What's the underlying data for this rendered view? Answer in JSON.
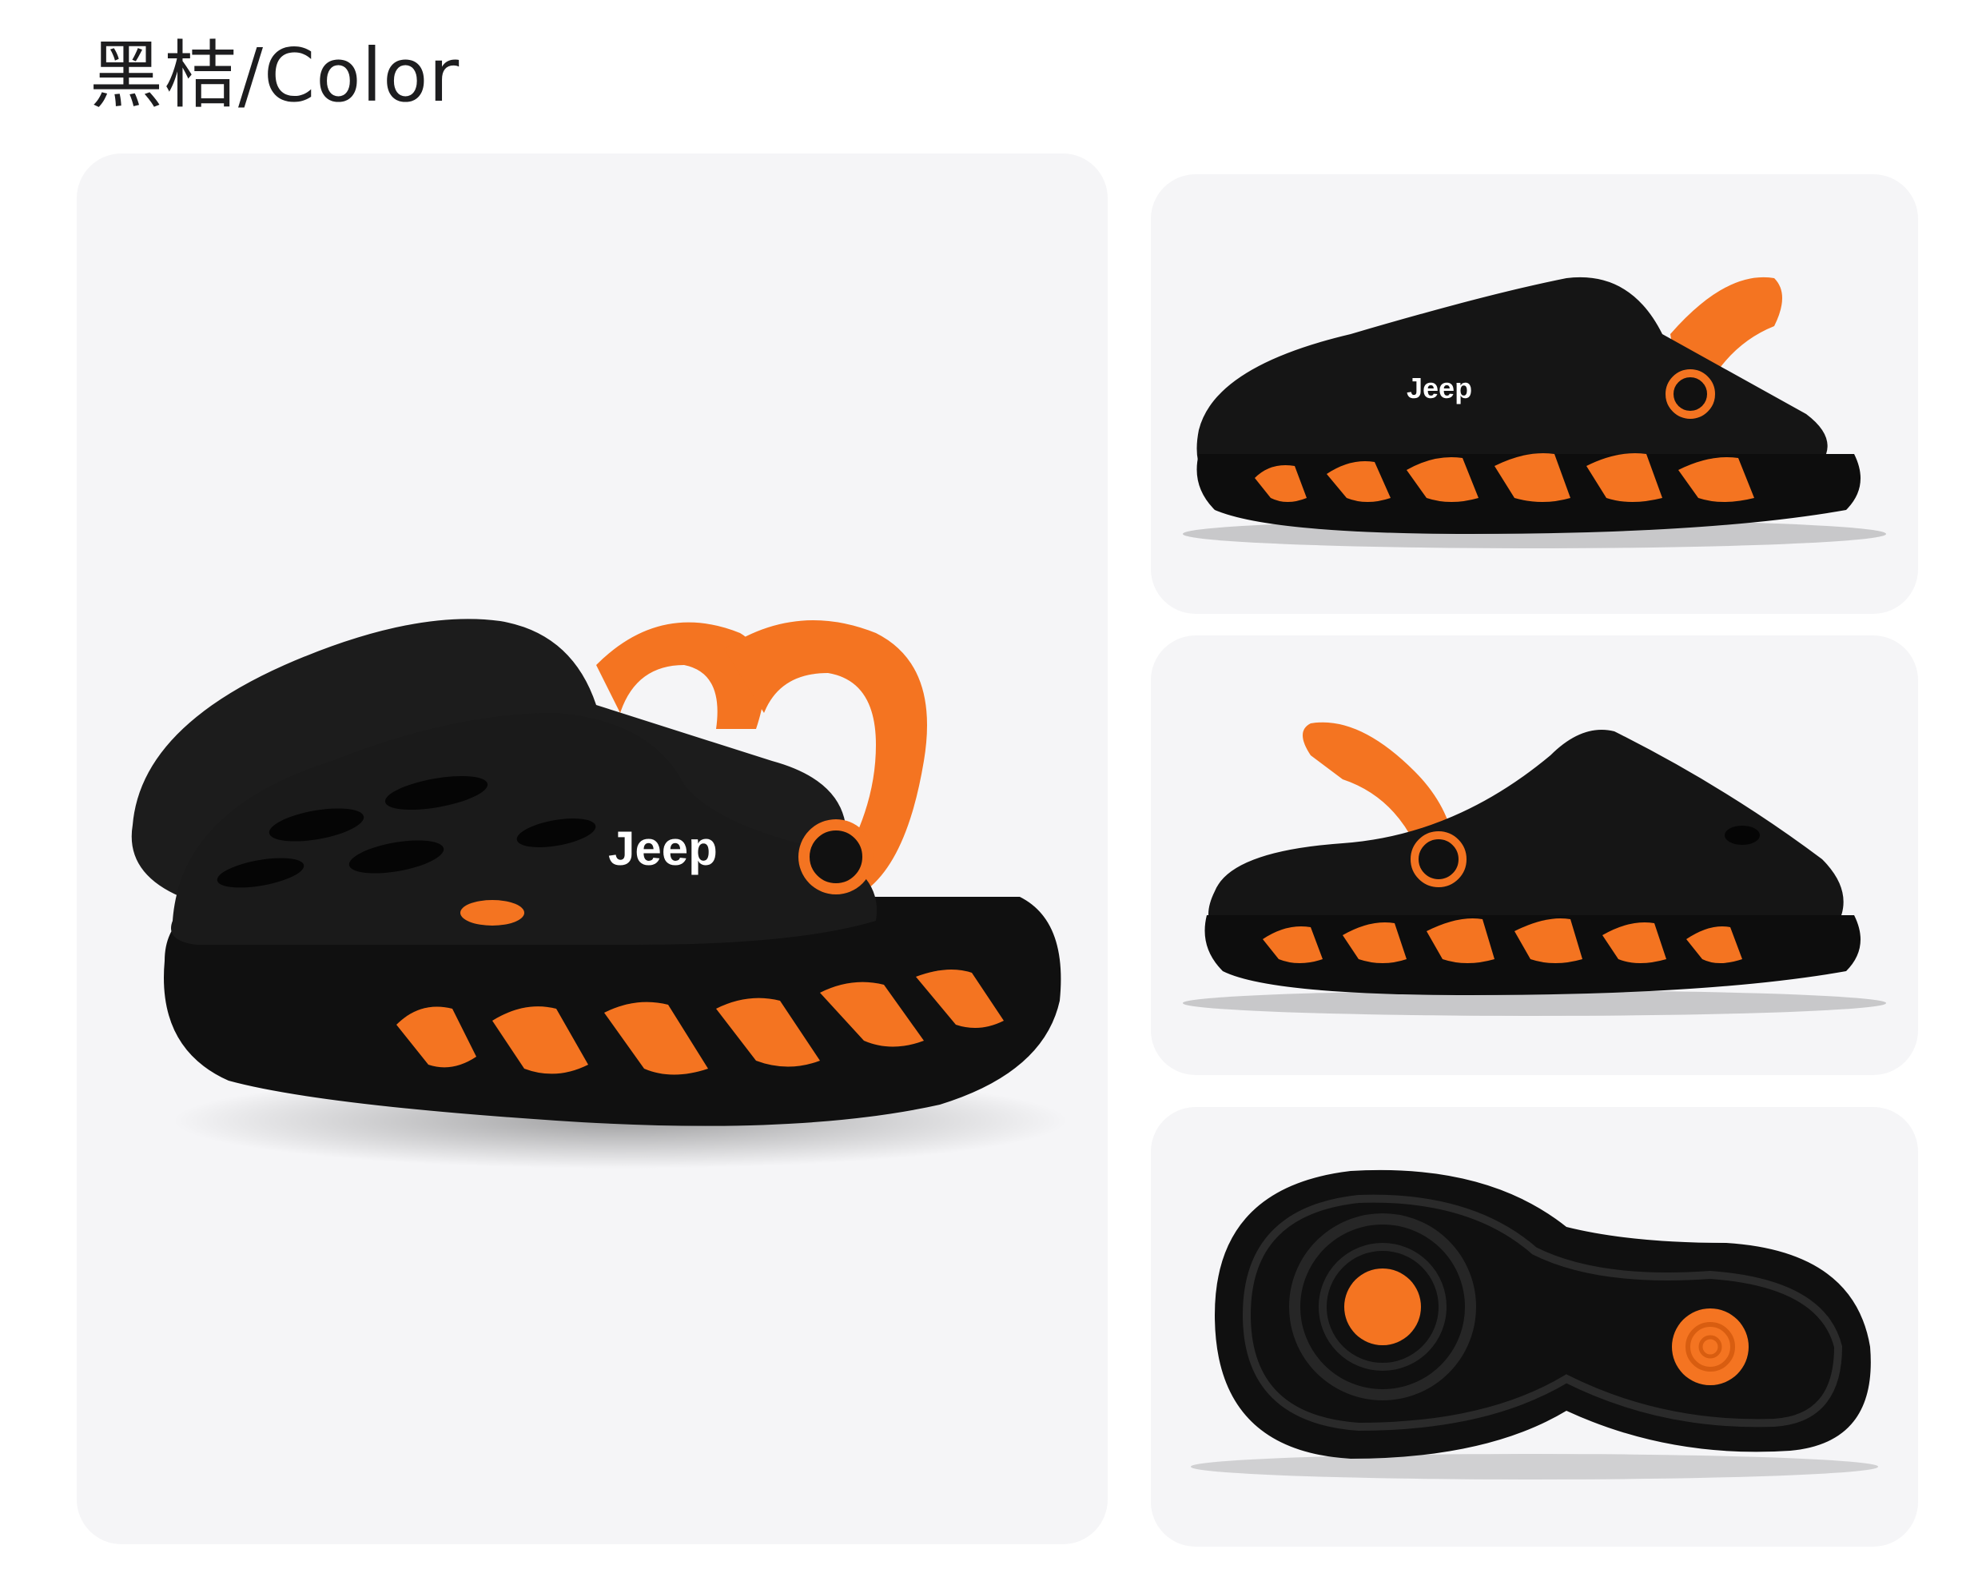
{
  "header": {
    "title": "黑桔/Color"
  },
  "product": {
    "brand_logo": "Jeep",
    "colors": {
      "body": "#151515",
      "accent": "#f47421",
      "background": "#f5f5f7"
    },
    "views": [
      {
        "name": "pair-angle-view"
      },
      {
        "name": "side-view-right"
      },
      {
        "name": "side-view-left"
      },
      {
        "name": "sole-view"
      }
    ]
  }
}
